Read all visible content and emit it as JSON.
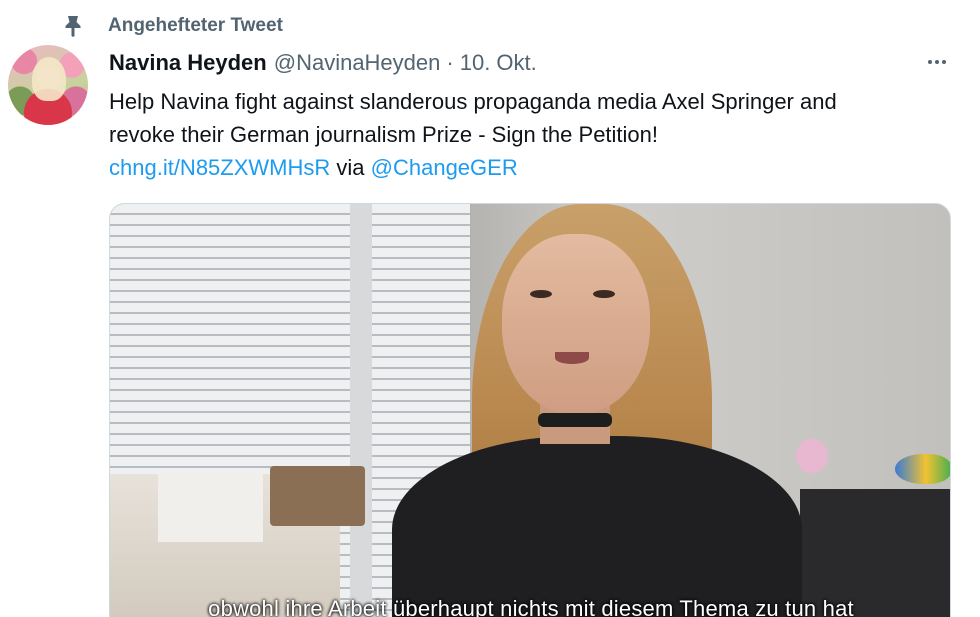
{
  "pinned": {
    "label": "Angehefteter Tweet",
    "icon": "pin-icon"
  },
  "tweet": {
    "display_name": "Navina Heyden",
    "handle": "@NavinaHeyden",
    "separator": "·",
    "date": "10. Okt.",
    "text_line1": "Help Navina fight against slanderous propaganda media Axel Springer and",
    "text_line2": "revoke their German journalism Prize - Sign the Petition!",
    "link_url": "chng.it/N85ZXWMHsR",
    "via_text": " via ",
    "via_handle": "@ChangeGER",
    "more_icon": "more-dots-icon"
  },
  "media": {
    "subtitle": "obwohl ihre Arbeit überhaupt nichts mit diesem Thema zu tun hat"
  },
  "colors": {
    "link": "#1d9bf0",
    "secondary_text": "#536471",
    "primary_text": "#0f1419"
  }
}
